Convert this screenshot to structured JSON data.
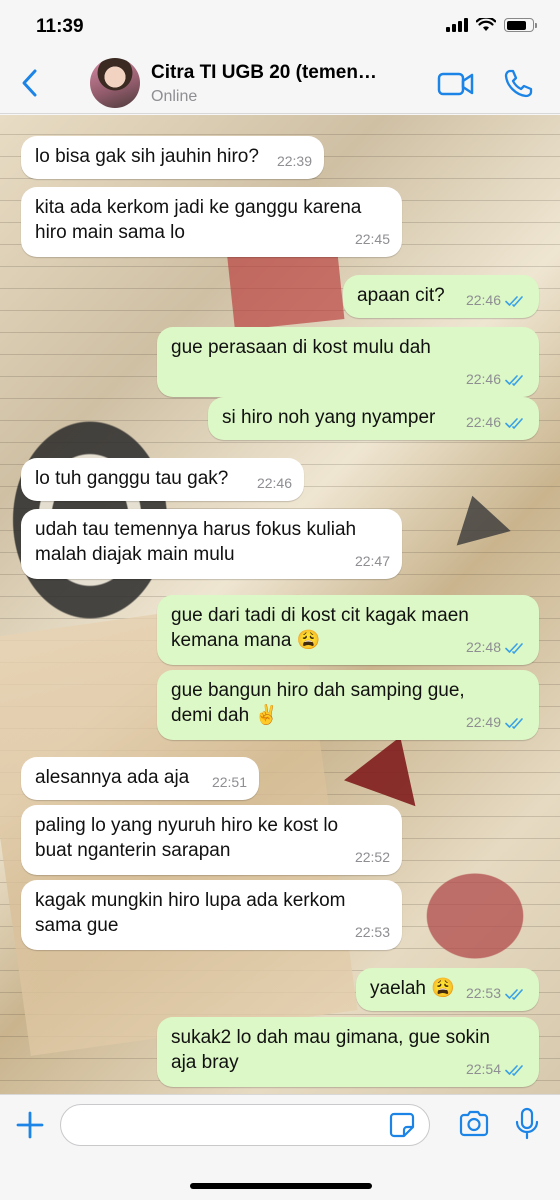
{
  "status_bar": {
    "time": "11:39",
    "battery_level": 0.78
  },
  "header": {
    "back_icon": "chevron-left-icon",
    "contact_name": "Citra TI UGB 20 (temen…",
    "contact_status": "Online",
    "video_icon": "video-camera-icon",
    "call_icon": "phone-icon"
  },
  "colors": {
    "accent": "#1c84e6",
    "outgoing_bubble": "#dcf8c6",
    "incoming_bubble": "#ffffff",
    "read_tick": "#3aa0e8"
  },
  "messages": [
    {
      "dir": "in",
      "text": "lo bisa gak sih jauhin hiro?",
      "time": "22:39"
    },
    {
      "dir": "in",
      "text": "kita ada kerkom jadi ke ganggu karena\nhiro main sama lo",
      "time": "22:45"
    },
    {
      "dir": "out",
      "text": "apaan cit?",
      "time": "22:46",
      "status": "read"
    },
    {
      "dir": "out",
      "text": "gue perasaan di kost mulu dah",
      "time": "22:46",
      "status": "read"
    },
    {
      "dir": "out",
      "text": "si hiro noh yang nyamper",
      "time": "22:46",
      "status": "read"
    },
    {
      "dir": "in",
      "text": "lo tuh ganggu tau gak?",
      "time": "22:46"
    },
    {
      "dir": "in",
      "text": "udah tau temennya harus fokus kuliah\nmalah diajak main mulu",
      "time": "22:47"
    },
    {
      "dir": "out",
      "text": "gue dari tadi di kost cit kagak maen\nkemana mana 😩",
      "time": "22:48",
      "status": "read"
    },
    {
      "dir": "out",
      "text": "gue bangun hiro dah samping gue,\ndemi dah ✌️",
      "time": "22:49",
      "status": "read"
    },
    {
      "dir": "in",
      "text": "alesannya ada aja",
      "time": "22:51"
    },
    {
      "dir": "in",
      "text": "paling lo yang nyuruh hiro ke kost lo\nbuat nganterin sarapan",
      "time": "22:52"
    },
    {
      "dir": "in",
      "text": "kagak mungkin hiro lupa ada kerkom\nsama gue",
      "time": "22:53"
    },
    {
      "dir": "out",
      "text": "yaelah 😩",
      "time": "22:53",
      "status": "read"
    },
    {
      "dir": "out",
      "text": "sukak2 lo dah mau gimana, gue sokin\naja bray",
      "time": "22:54",
      "status": "read"
    }
  ],
  "input_bar": {
    "plus_icon": "plus-icon",
    "placeholder": "",
    "sticker_icon": "sticker-icon",
    "camera_icon": "camera-icon",
    "mic_icon": "microphone-icon"
  }
}
